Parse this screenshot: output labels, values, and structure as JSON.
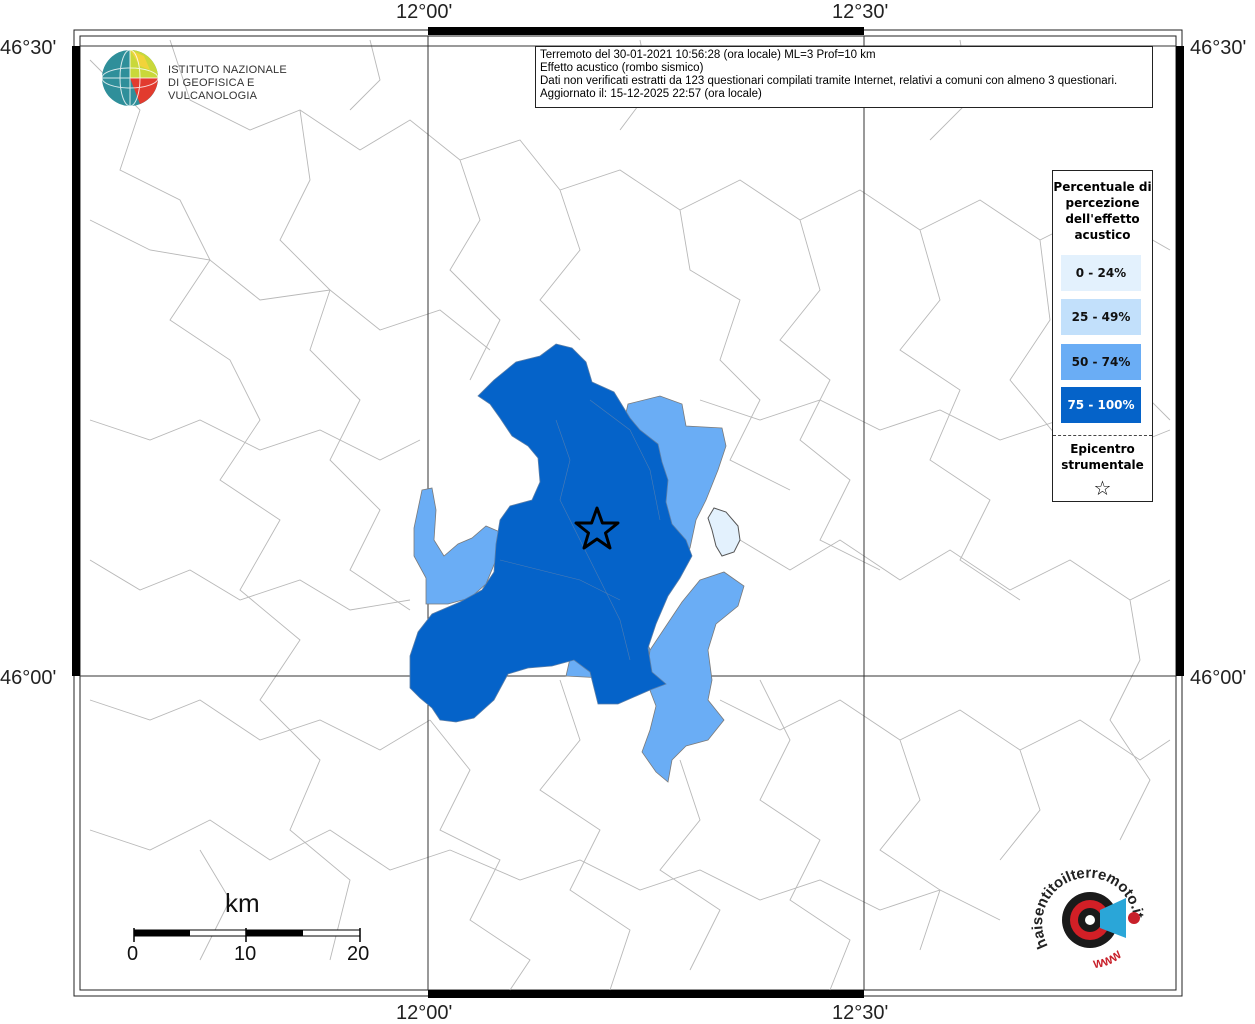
{
  "map": {
    "lat_labels": {
      "north": "46°30'",
      "south": "46°00'"
    },
    "lon_labels": {
      "west": "12°00'",
      "east": "12°30'"
    }
  },
  "header": {
    "line1": "Terremoto del 30-01-2021 10:56:28 (ora locale) ML=3 Prof=10 km",
    "line2": "Effetto acustico (rombo sismico)",
    "line3": "Dati non verificati estratti da 123 questionari compilati tramite Internet, relativi a comuni con almeno 3 questionari.",
    "line4": "Aggiornato il: 15-12-2025 22:57 (ora locale)"
  },
  "ingv": {
    "name_line1": "ISTITUTO NAZIONALE",
    "name_line2": "DI GEOFISICA E VULCANOLOGIA"
  },
  "legend": {
    "title": "Percentuale di percezione dell'effetto acustico",
    "classes": [
      {
        "label": "0 - 24%",
        "color": "#e3f1fd"
      },
      {
        "label": "25 - 49%",
        "color": "#c2e0fb"
      },
      {
        "label": "50 - 74%",
        "color": "#6aadf5"
      },
      {
        "label": "75 - 100%",
        "color": "#0563c9"
      }
    ],
    "epicenter_label": "Epicentro strumentale",
    "epicenter_symbol": "☆"
  },
  "scale": {
    "unit": "km",
    "ticks": [
      "0",
      "10",
      "20"
    ]
  },
  "hsi_logo": {
    "text_arc": "haisentitoilterremoto.it",
    "www": "WWW"
  }
}
